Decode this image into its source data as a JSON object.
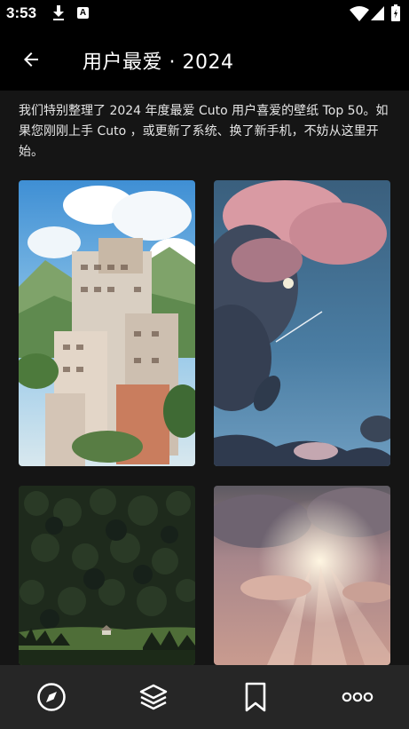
{
  "status_bar": {
    "time": "3:53",
    "icons": [
      "download-icon",
      "a-notification-icon",
      "wifi-icon",
      "signal-icon",
      "battery-icon"
    ]
  },
  "header": {
    "title": "用户最爱 · 2024",
    "back_icon": "arrow-left-icon"
  },
  "description": "我们特别整理了 2024 年度最爱 Cuto 用户喜爱的壁纸 Top 50。如果您刚刚上手 Cuto ，或更新了系统、换了新手机，不妨从这里开始。",
  "wallpapers": [
    {
      "subject": "anime-city-buildings"
    },
    {
      "subject": "clouds-moon-sky"
    },
    {
      "subject": "forest-meadow-cabin"
    },
    {
      "subject": "sunlit-clouds"
    }
  ],
  "bottom_nav": {
    "items": [
      "compass-icon",
      "layers-icon",
      "bookmark-icon",
      "more-icon"
    ]
  },
  "colors": {
    "background": "#151515",
    "bars": "#000000",
    "bottom_nav": "#262626"
  }
}
